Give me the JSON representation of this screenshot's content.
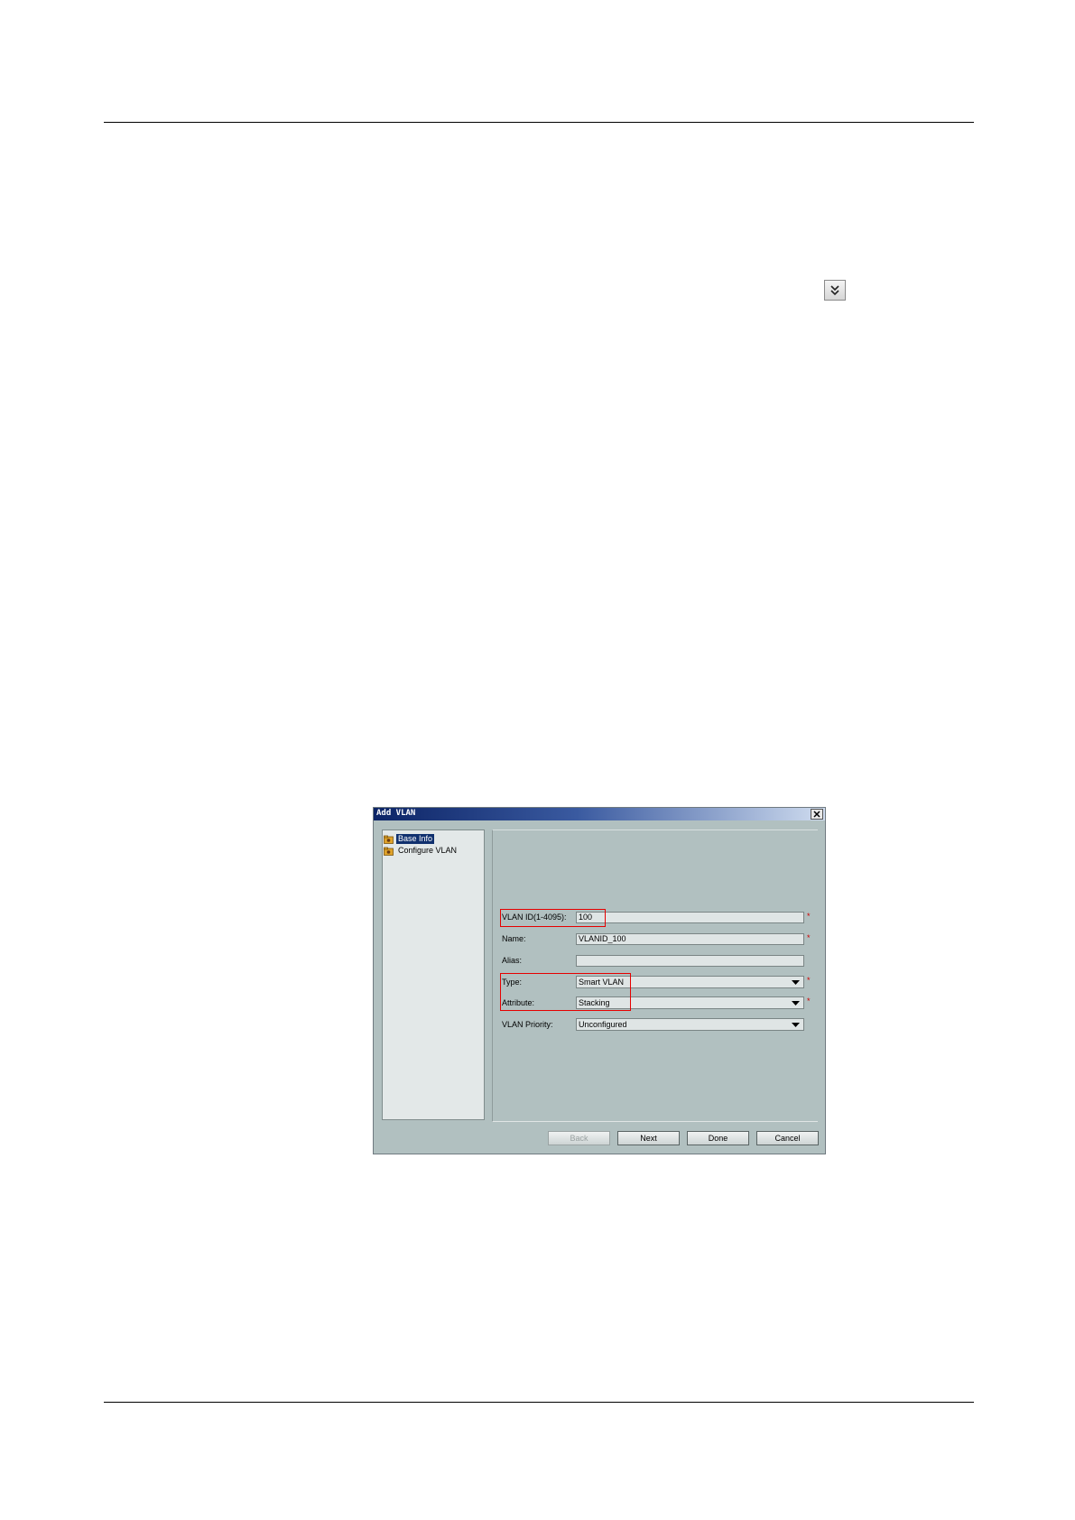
{
  "page": {
    "expand_icon": "double-chevron-down-icon"
  },
  "dialog": {
    "title": "Add VLAN",
    "close_icon": "close-icon",
    "tree": [
      {
        "label": "Base Info",
        "icon": "folder-gear-icon",
        "selected": true
      },
      {
        "label": "Configure VLAN",
        "icon": "folder-gear-icon",
        "selected": false
      }
    ],
    "fields": {
      "vlan_id": {
        "label": "VLAN ID(1-4095):",
        "value": "100",
        "required": "*"
      },
      "name": {
        "label": "Name:",
        "value": "VLANID_100",
        "required": "*"
      },
      "alias": {
        "label": "Alias:",
        "value": ""
      },
      "type": {
        "label": "Type:",
        "value": "Smart VLAN",
        "required": "*"
      },
      "attribute": {
        "label": "Attribute:",
        "value": "Stacking",
        "required": "*"
      },
      "vlan_priority": {
        "label": "VLAN Priority:",
        "value": "Unconfigured"
      }
    },
    "buttons": {
      "back": "Back",
      "next": "Next",
      "done": "Done",
      "cancel": "Cancel"
    },
    "colors": {
      "highlight": "#e60000",
      "titlebar": "#0c2466",
      "panel": "#b1c0c0"
    }
  }
}
